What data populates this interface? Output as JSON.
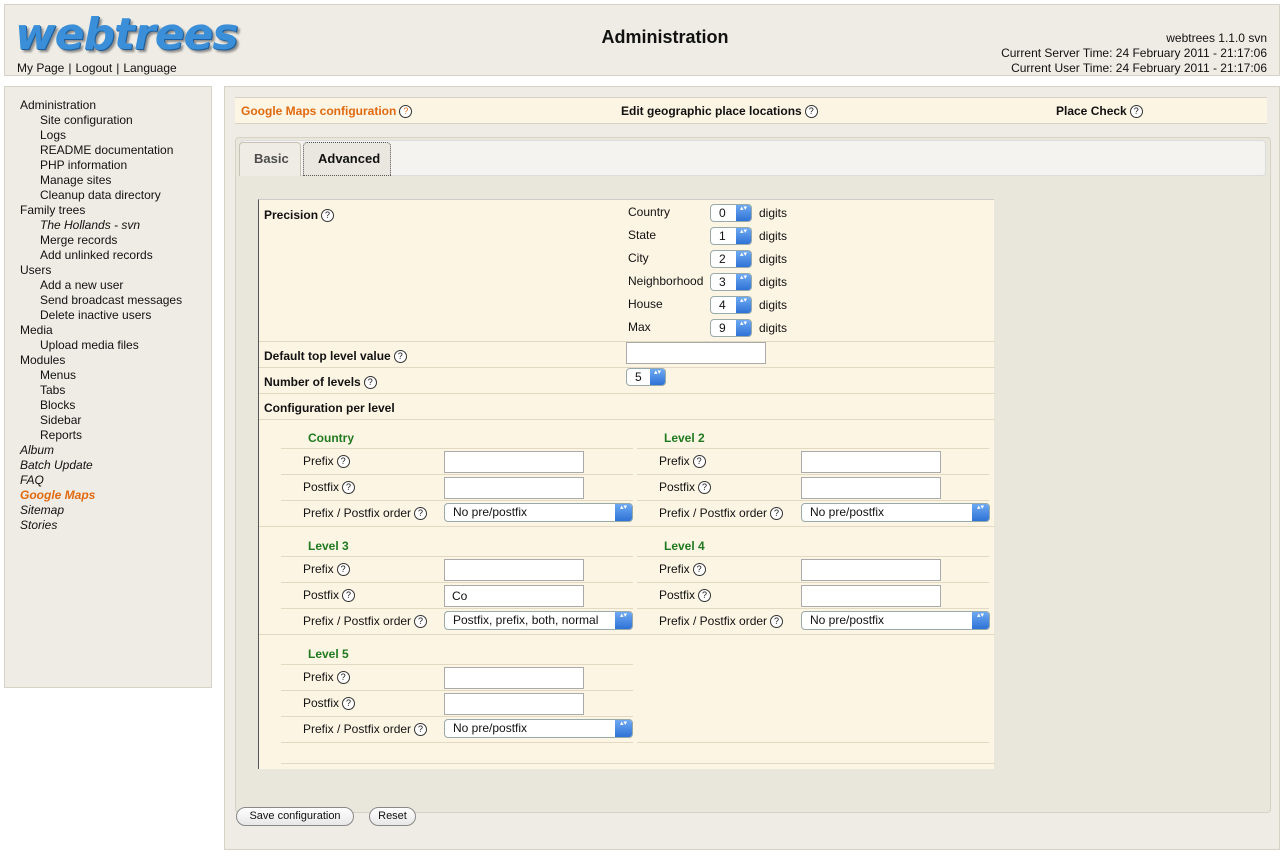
{
  "header": {
    "logo": "webtrees",
    "links": [
      "My Page",
      "Logout",
      "Language"
    ],
    "title": "Administration",
    "version": "webtrees 1.1.0 svn",
    "server_time": "Current Server Time: 24 February 2011 - 21:17:06",
    "user_time": "Current User Time: 24 February 2011 - 21:17:06"
  },
  "sidebar": {
    "administration": "Administration",
    "site_configuration": "Site configuration",
    "logs": "Logs",
    "readme": "README documentation",
    "php_info": "PHP information",
    "manage_sites": "Manage sites",
    "cleanup": "Cleanup data directory",
    "family_trees": "Family trees",
    "hollands": "The Hollands - svn",
    "merge_records": "Merge records",
    "add_unlinked": "Add unlinked records",
    "users": "Users",
    "add_user": "Add a new user",
    "broadcast": "Send broadcast messages",
    "delete_inactive": "Delete inactive users",
    "media": "Media",
    "upload_media": "Upload media files",
    "modules": "Modules",
    "menus": "Menus",
    "tabs": "Tabs",
    "blocks": "Blocks",
    "sidebar_item": "Sidebar",
    "reports": "Reports",
    "album": "Album",
    "batch_update": "Batch Update",
    "faq": "FAQ",
    "google_maps": "Google Maps",
    "sitemap": "Sitemap",
    "stories": "Stories"
  },
  "topbar": {
    "gm_config": "Google Maps configuration",
    "edit_places": "Edit geographic place locations",
    "place_check": "Place Check"
  },
  "tabs": {
    "basic": "Basic",
    "advanced": "Advanced"
  },
  "precision": {
    "label": "Precision",
    "digits": "digits",
    "rows": [
      {
        "name": "Country",
        "value": "0"
      },
      {
        "name": "State",
        "value": "1"
      },
      {
        "name": "City",
        "value": "2"
      },
      {
        "name": "Neighborhood",
        "value": "3"
      },
      {
        "name": "House",
        "value": "4"
      },
      {
        "name": "Max",
        "value": "9"
      }
    ]
  },
  "default_top_level": {
    "label": "Default top level value",
    "value": ""
  },
  "num_levels": {
    "label": "Number of levels",
    "value": "5"
  },
  "config_per_level": "Configuration per level",
  "level_fields": {
    "prefix": "Prefix",
    "postfix": "Postfix",
    "order": "Prefix / Postfix order"
  },
  "levels": [
    {
      "title": "Country",
      "prefix": "",
      "postfix": "",
      "order": "No pre/postfix"
    },
    {
      "title": "Level 2",
      "prefix": "",
      "postfix": "",
      "order": "No pre/postfix"
    },
    {
      "title": "Level 3",
      "prefix": "",
      "postfix": "Co",
      "order": "Postfix, prefix, both, normal"
    },
    {
      "title": "Level 4",
      "prefix": "",
      "postfix": "",
      "order": "No pre/postfix"
    },
    {
      "title": "Level 5",
      "prefix": "",
      "postfix": "",
      "order": "No pre/postfix"
    }
  ],
  "buttons": {
    "save": "Save configuration",
    "reset": "Reset"
  },
  "help_glyph": "?",
  "spin_glyph": "▴▾",
  "link_sep": "|"
}
